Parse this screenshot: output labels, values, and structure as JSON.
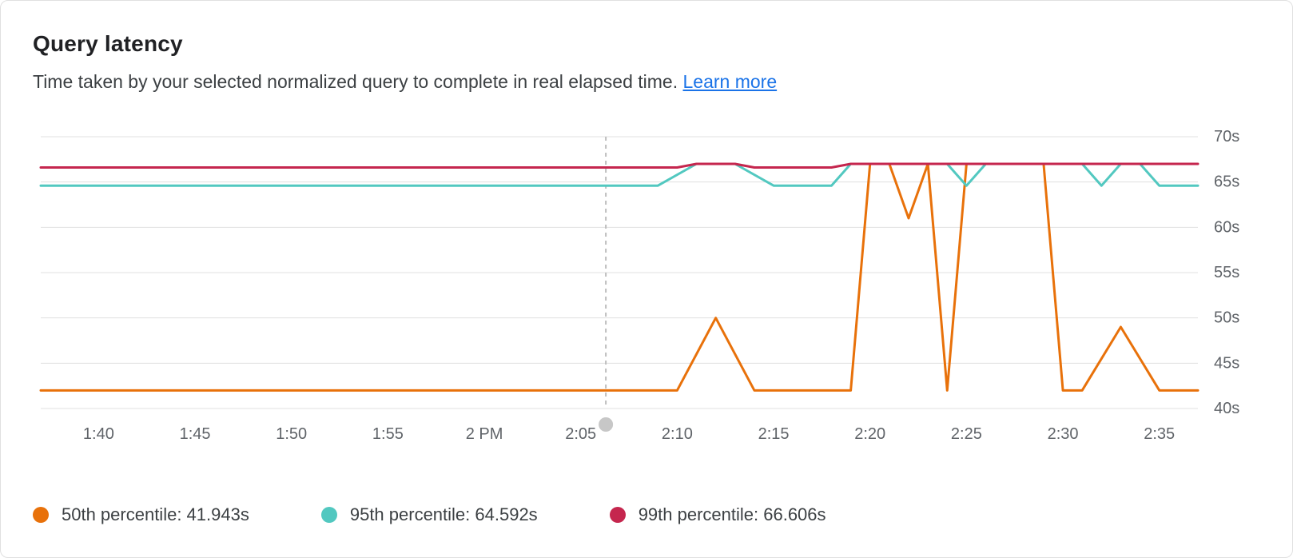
{
  "title": "Query latency",
  "subtitle_prefix": "Time taken by your selected normalized query to complete in real elapsed time. ",
  "learn_more": "Learn more",
  "legend": {
    "s0": {
      "label": "50th percentile: ",
      "value": "41.943s",
      "color": "#e8710a"
    },
    "s1": {
      "label": "95th percentile: ",
      "value": "64.592s",
      "color": "#52c8c0"
    },
    "s2": {
      "label": "99th percentile: ",
      "value": "66.606s",
      "color": "#c5264e"
    }
  },
  "chart_data": {
    "type": "line",
    "xlabel": "",
    "ylabel": "",
    "ylim": [
      40,
      70
    ],
    "y_ticks": [
      40,
      45,
      50,
      55,
      60,
      65,
      70
    ],
    "y_tick_labels": [
      "40s",
      "45s",
      "50s",
      "55s",
      "60s",
      "65s",
      "70s"
    ],
    "x_range_minutes": [
      97,
      157
    ],
    "x_ticks_minutes": [
      100,
      105,
      110,
      115,
      120,
      125,
      130,
      135,
      140,
      145,
      150,
      155
    ],
    "x_tick_labels": [
      "1:40",
      "1:45",
      "1:50",
      "1:55",
      "2 PM",
      "2:05",
      "2:10",
      "2:15",
      "2:20",
      "2:25",
      "2:30",
      "2:35"
    ],
    "cursor_minute": 126.3,
    "series": [
      {
        "name": "50th percentile",
        "color": "#e8710a",
        "points": [
          {
            "x": 97,
            "y": 42.0
          },
          {
            "x": 130,
            "y": 42.0
          },
          {
            "x": 132,
            "y": 50.0
          },
          {
            "x": 134,
            "y": 42.0
          },
          {
            "x": 139,
            "y": 42.0
          },
          {
            "x": 140,
            "y": 67.0
          },
          {
            "x": 141,
            "y": 67.0
          },
          {
            "x": 142,
            "y": 61.0
          },
          {
            "x": 143,
            "y": 67.0
          },
          {
            "x": 144,
            "y": 42.0
          },
          {
            "x": 145,
            "y": 67.0
          },
          {
            "x": 149,
            "y": 67.0
          },
          {
            "x": 150,
            "y": 42.0
          },
          {
            "x": 151,
            "y": 42.0
          },
          {
            "x": 153,
            "y": 49.0
          },
          {
            "x": 155,
            "y": 42.0
          },
          {
            "x": 157,
            "y": 42.0
          }
        ]
      },
      {
        "name": "95th percentile",
        "color": "#52c8c0",
        "points": [
          {
            "x": 97,
            "y": 64.6
          },
          {
            "x": 129,
            "y": 64.6
          },
          {
            "x": 131,
            "y": 67.0
          },
          {
            "x": 133,
            "y": 67.0
          },
          {
            "x": 135,
            "y": 64.6
          },
          {
            "x": 138,
            "y": 64.6
          },
          {
            "x": 139,
            "y": 67.0
          },
          {
            "x": 144,
            "y": 67.0
          },
          {
            "x": 145,
            "y": 64.6
          },
          {
            "x": 146,
            "y": 67.0
          },
          {
            "x": 151,
            "y": 67.0
          },
          {
            "x": 152,
            "y": 64.6
          },
          {
            "x": 153,
            "y": 67.0
          },
          {
            "x": 154,
            "y": 67.0
          },
          {
            "x": 155,
            "y": 64.6
          },
          {
            "x": 157,
            "y": 64.6
          }
        ]
      },
      {
        "name": "99th percentile",
        "color": "#c5264e",
        "points": [
          {
            "x": 97,
            "y": 66.6
          },
          {
            "x": 130,
            "y": 66.6
          },
          {
            "x": 131,
            "y": 67.0
          },
          {
            "x": 133,
            "y": 67.0
          },
          {
            "x": 134,
            "y": 66.6
          },
          {
            "x": 138,
            "y": 66.6
          },
          {
            "x": 139,
            "y": 67.0
          },
          {
            "x": 157,
            "y": 67.0
          }
        ]
      }
    ]
  }
}
